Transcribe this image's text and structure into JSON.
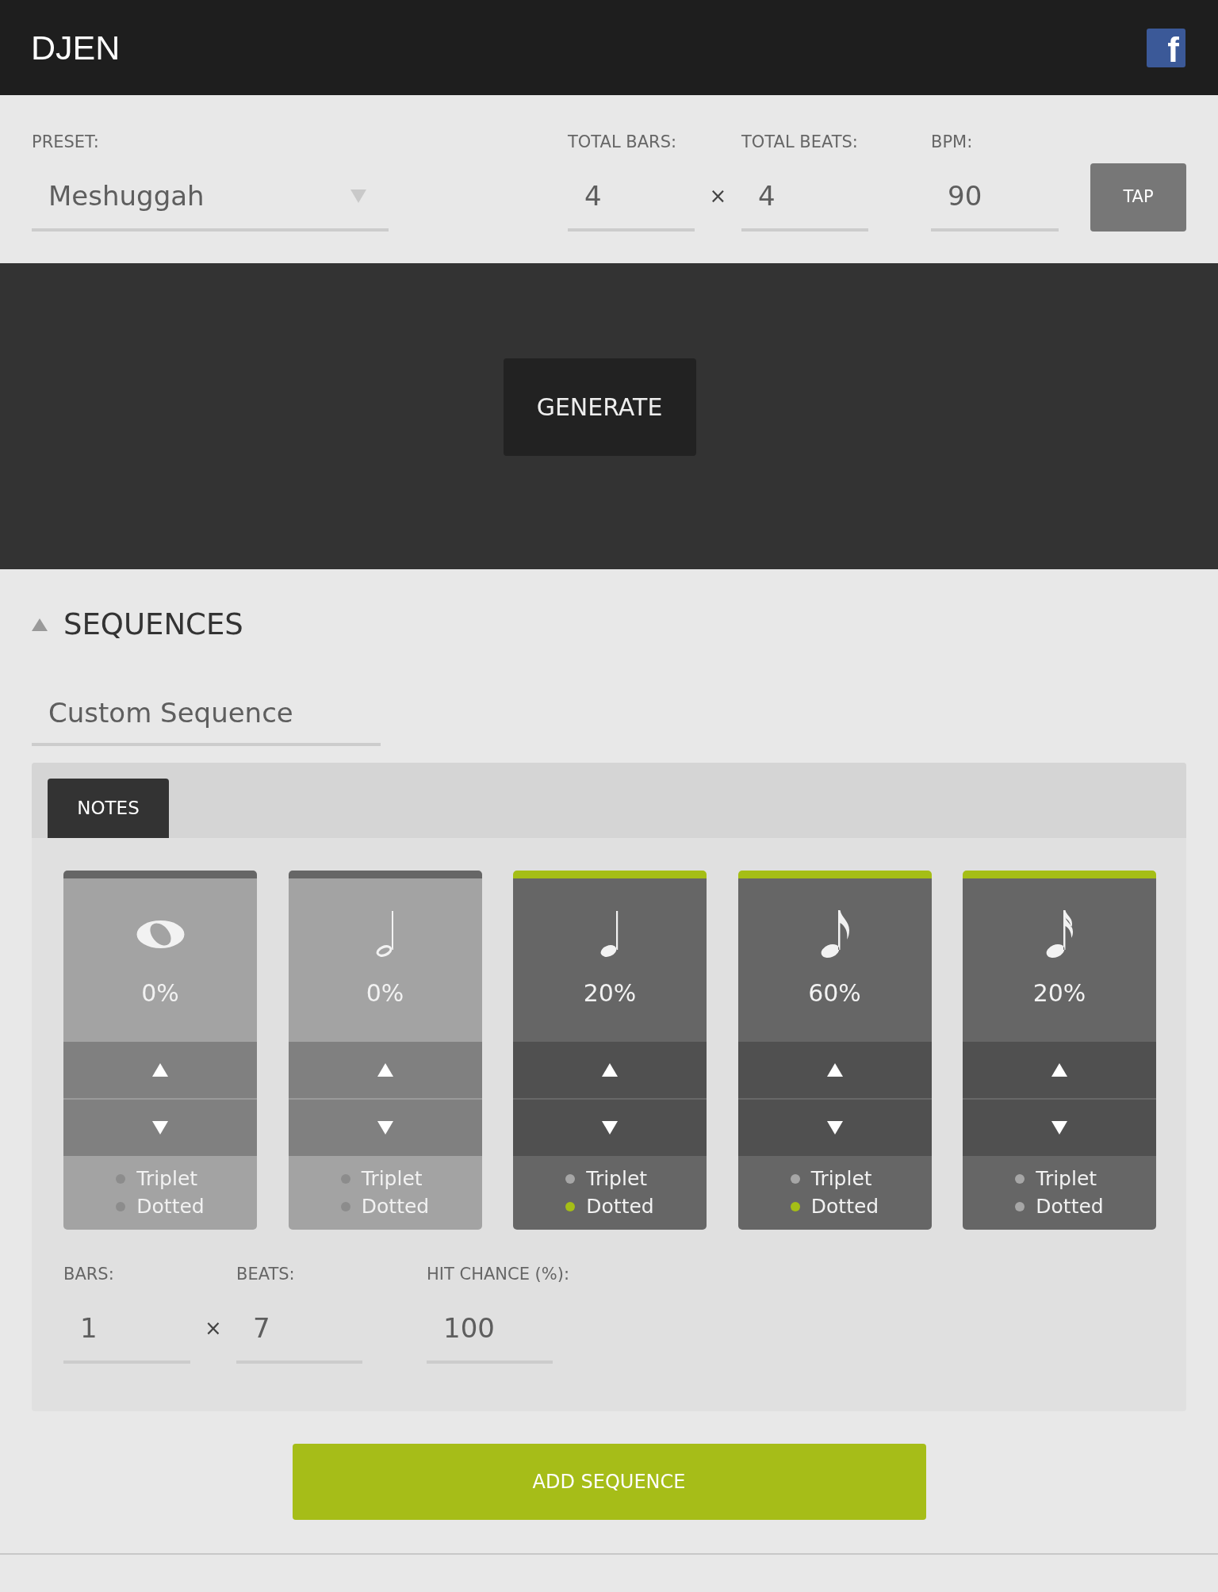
{
  "header": {
    "title": "DJEN",
    "share_link": "f"
  },
  "settings": {
    "preset": {
      "label": "PRESET:",
      "value": "Meshuggah"
    },
    "total_bars": {
      "label": "TOTAL BARS:",
      "value": "4"
    },
    "times_sign": "×",
    "total_beats": {
      "label": "TOTAL BEATS:",
      "value": "4"
    },
    "bpm": {
      "label": "BPM:",
      "value": "90"
    },
    "tap_button": "TAP"
  },
  "generate_button": "GENERATE",
  "sequences": {
    "title": "SEQUENCES",
    "expanded": true,
    "name_field": {
      "value": "Custom Sequence"
    },
    "tabs": [
      {
        "label": "NOTES",
        "selected": true
      }
    ],
    "notes": [
      {
        "kind": "whole",
        "active": false,
        "percent": "0%",
        "options": [
          {
            "label": "Triplet",
            "on": false
          },
          {
            "label": "Dotted",
            "on": false
          }
        ]
      },
      {
        "kind": "half",
        "active": false,
        "percent": "0%",
        "options": [
          {
            "label": "Triplet",
            "on": false
          },
          {
            "label": "Dotted",
            "on": false
          }
        ]
      },
      {
        "kind": "quarter",
        "active": true,
        "percent": "20%",
        "options": [
          {
            "label": "Triplet",
            "on": false
          },
          {
            "label": "Dotted",
            "on": true
          }
        ]
      },
      {
        "kind": "eighth",
        "active": true,
        "percent": "60%",
        "options": [
          {
            "label": "Triplet",
            "on": false
          },
          {
            "label": "Dotted",
            "on": true
          }
        ]
      },
      {
        "kind": "sixteenth",
        "active": true,
        "percent": "20%",
        "options": [
          {
            "label": "Triplet",
            "on": false
          },
          {
            "label": "Dotted",
            "on": false
          }
        ]
      }
    ],
    "bars": {
      "label": "BARS:",
      "value": "1"
    },
    "times_sign": "×",
    "beats": {
      "label": "BEATS:",
      "value": "7"
    },
    "hit_chance": {
      "label": "HIT CHANCE (%):",
      "value": "100"
    },
    "add_button": "ADD SEQUENCE"
  }
}
